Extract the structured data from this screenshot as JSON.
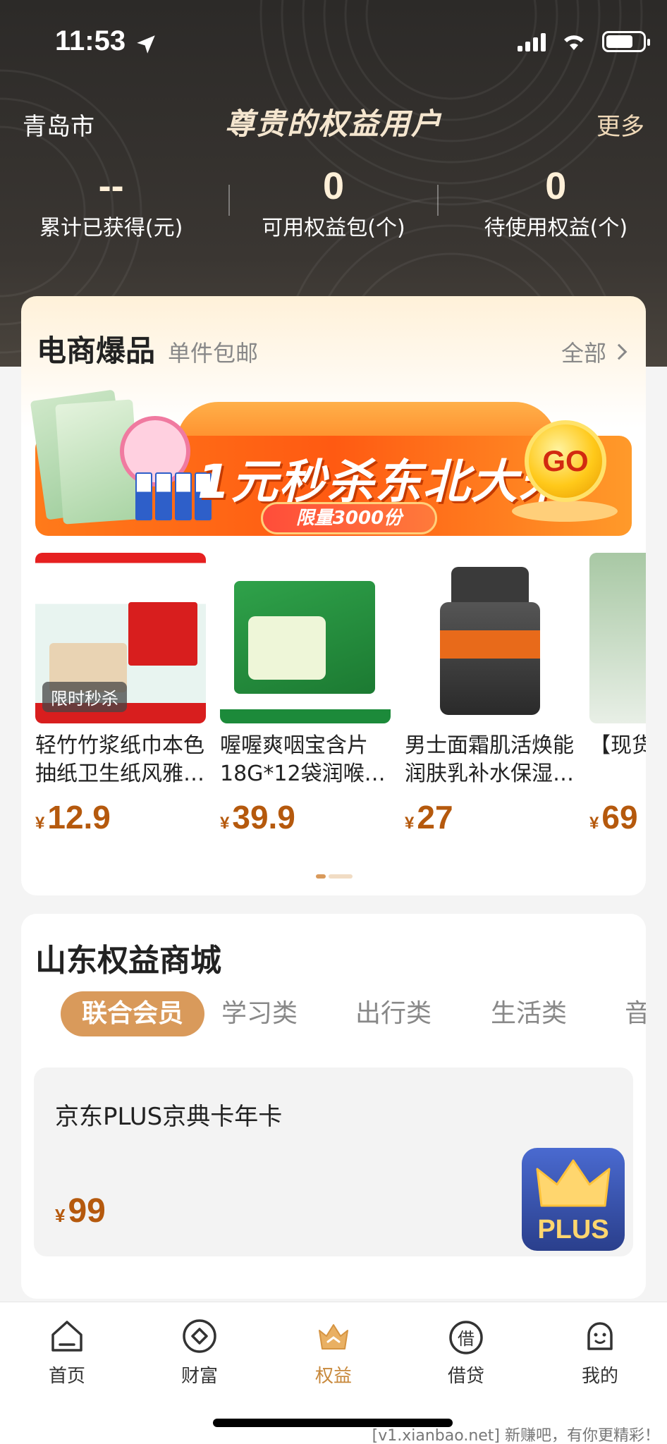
{
  "status_bar": {
    "time": "11:53",
    "location_icon": "location-arrow-icon",
    "signal_icon": "cellular-signal-icon",
    "wifi_icon": "wifi-icon",
    "battery_icon": "battery-icon"
  },
  "header": {
    "city": "青岛市",
    "title": "尊贵的权益用户",
    "more": "更多"
  },
  "stats": [
    {
      "value": "--",
      "label": "累计已获得(元)"
    },
    {
      "value": "0",
      "label": "可用权益包(个)"
    },
    {
      "value": "0",
      "label": "待使用权益(个)"
    }
  ],
  "ecommerce": {
    "title": "电商爆品",
    "subtitle": "单件包邮",
    "view_all": "全部",
    "banner": {
      "headline": "1元秒杀东北大米",
      "badge": "限量3000份",
      "go": "GO"
    },
    "products": [
      {
        "name": "轻竹竹浆纸巾本色抽纸卫生纸风雅…",
        "currency": "¥",
        "price": "12.9",
        "tag": "限时秒杀"
      },
      {
        "name": "喔喔爽咽宝含片18G*12袋润喉糖…",
        "currency": "¥",
        "price": "39.9",
        "tag": ""
      },
      {
        "name": "男士面霜肌活焕能润肤乳补水保湿…",
        "currency": "¥",
        "price": "27",
        "tag": ""
      },
      {
        "name": "【现货装鱼形…",
        "currency": "¥",
        "price": "69",
        "tag": ""
      }
    ]
  },
  "mall": {
    "title": "山东权益商城",
    "tabs": [
      "联合会员",
      "学习类",
      "出行类",
      "生活类",
      "音"
    ],
    "item": {
      "name": "京东PLUS京典卡年卡",
      "currency": "¥",
      "price": "99",
      "logo_text": "PLUS"
    }
  },
  "tabbar": [
    {
      "label": "首页",
      "icon": "home-icon"
    },
    {
      "label": "财富",
      "icon": "wealth-icon"
    },
    {
      "label": "权益",
      "icon": "crown-icon",
      "active": true
    },
    {
      "label": "借贷",
      "icon": "loan-icon"
    },
    {
      "label": "我的",
      "icon": "profile-icon"
    }
  ],
  "watermark": "[v1.xianbao.net] 新赚吧，有你更精彩！",
  "colors": {
    "accent": "#d99a5b",
    "price": "#b5590d",
    "hero_bg": "#2c2a28"
  }
}
